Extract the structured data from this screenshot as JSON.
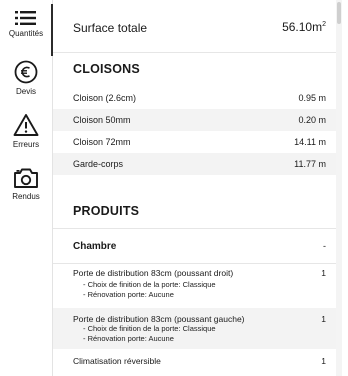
{
  "nav": [
    {
      "label": "Quantités",
      "icon": "list-icon",
      "active": true
    },
    {
      "label": "Devis",
      "icon": "euro-icon"
    },
    {
      "label": "Erreurs",
      "icon": "warning-icon"
    },
    {
      "label": "Rendus",
      "icon": "camera-icon"
    }
  ],
  "surface": {
    "label": "Surface totale",
    "value": "56.10m",
    "unit_sup": "2"
  },
  "cloisons": {
    "title": "CLOISONS",
    "rows": [
      {
        "label": "Cloison (2.6cm)",
        "value": "0.95 m"
      },
      {
        "label": "Cloison 50mm",
        "value": "0.20 m"
      },
      {
        "label": "Cloison 72mm",
        "value": "14.11 m"
      },
      {
        "label": "Garde-corps",
        "value": "11.77 m"
      }
    ]
  },
  "produits": {
    "title": "PRODUITS",
    "group": {
      "label": "Chambre",
      "value": "-"
    },
    "items": [
      {
        "name": "Porte de distribution 83cm (poussant droit)",
        "qty": "1",
        "opt1": "- Choix de finition de la porte: Classique",
        "opt2": "- Rénovation porte: Aucune"
      },
      {
        "name": "Porte de distribution 83cm (poussant gauche)",
        "qty": "1",
        "opt1": "- Choix de finition de la porte: Classique",
        "opt2": "- Rénovation porte: Aucune"
      },
      {
        "name": "Climatisation réversible",
        "qty": "1"
      }
    ]
  }
}
